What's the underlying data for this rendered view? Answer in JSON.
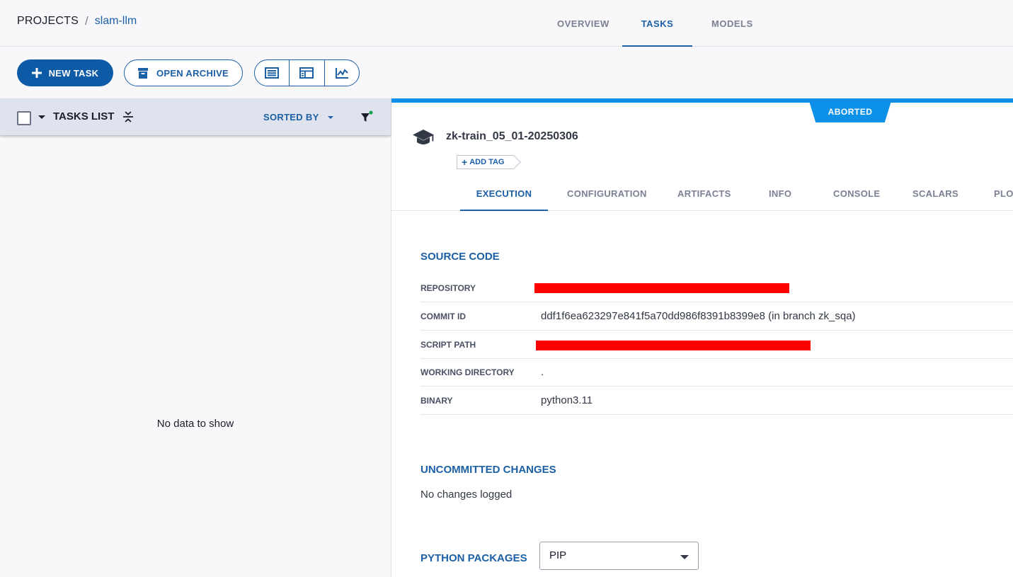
{
  "header": {
    "breadcrumb_root": "PROJECTS",
    "breadcrumb_sep": "/",
    "project": "slam-llm",
    "tabs": [
      {
        "label": "OVERVIEW",
        "active": false
      },
      {
        "label": "TASKS",
        "active": true
      },
      {
        "label": "MODELS",
        "active": false
      }
    ]
  },
  "toolbar": {
    "new_task_label": "NEW TASK",
    "open_archive_label": "OPEN ARCHIVE",
    "view_icons": [
      "table-view-icon",
      "details-view-icon",
      "compare-chart-icon"
    ]
  },
  "tasks_list": {
    "title": "TASKS LIST",
    "sorted_by_label": "SORTED BY",
    "empty_text": "No data to show"
  },
  "task": {
    "status": "ABORTED",
    "name": "zk-train_05_01-20250306",
    "add_tag_label": "ADD TAG",
    "tabs": [
      "EXECUTION",
      "CONFIGURATION",
      "ARTIFACTS",
      "INFO",
      "CONSOLE",
      "SCALARS",
      "PLOTS"
    ],
    "active_tab": "EXECUTION"
  },
  "execution": {
    "source_code_title": "SOURCE CODE",
    "rows": {
      "repository_label": "REPOSITORY",
      "commit_label": "COMMIT ID",
      "commit_value": "ddf1f6ea623297e841f5a70dd986f8391b8399e8 (in branch zk_sqa)",
      "script_label": "SCRIPT PATH",
      "workdir_label": "WORKING DIRECTORY",
      "workdir_value": ".",
      "binary_label": "BINARY",
      "binary_value": "python3.11"
    },
    "uncommitted_title": "UNCOMMITTED CHANGES",
    "uncommitted_text": "No changes logged",
    "packages_title": "PYTHON PACKAGES",
    "packages_select": "PIP"
  },
  "colors": {
    "accent": "#1b5fa5",
    "status_bar": "#0d91e8",
    "redaction": "#fe0000"
  }
}
